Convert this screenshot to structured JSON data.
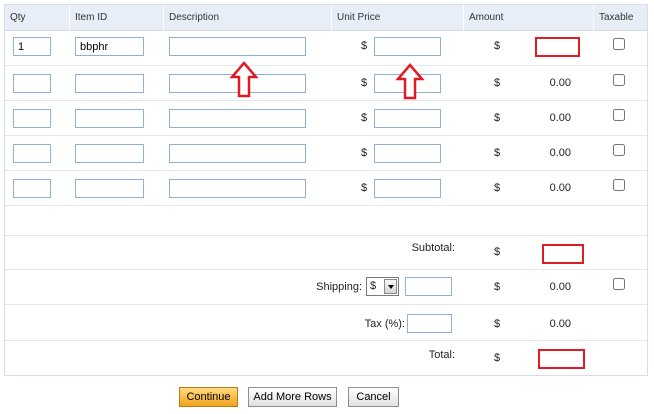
{
  "columns": {
    "qty": "Qty",
    "item_id": "Item ID",
    "description": "Description",
    "unit_price": "Unit Price",
    "amount": "Amount",
    "taxable": "Taxable"
  },
  "currency_symbol": "$",
  "rows": [
    {
      "qty": "1",
      "item_id": "bbphr",
      "description": "",
      "unit_price": "",
      "amount": "",
      "taxable": false
    },
    {
      "qty": "",
      "item_id": "",
      "description": "",
      "unit_price": "",
      "amount": "0.00",
      "taxable": false
    },
    {
      "qty": "",
      "item_id": "",
      "description": "",
      "unit_price": "",
      "amount": "0.00",
      "taxable": false
    },
    {
      "qty": "",
      "item_id": "",
      "description": "",
      "unit_price": "",
      "amount": "0.00",
      "taxable": false
    },
    {
      "qty": "",
      "item_id": "",
      "description": "",
      "unit_price": "",
      "amount": "0.00",
      "taxable": false
    }
  ],
  "totals": {
    "subtotal_label": "Subtotal:",
    "subtotal_value": "",
    "shipping_label": "Shipping:",
    "shipping_type": "$",
    "shipping_value": "",
    "shipping_amount": "0.00",
    "tax_label": "Tax (%):",
    "tax_value": "",
    "tax_amount": "0.00",
    "total_label": "Total:",
    "total_value": ""
  },
  "buttons": {
    "continue": "Continue",
    "add_rows": "Add More Rows",
    "cancel": "Cancel"
  },
  "annotation_color": "#e01b24"
}
